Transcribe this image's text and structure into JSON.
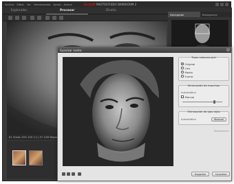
{
  "app": {
    "menu": [
      "Archivo",
      "Editar",
      "Ver",
      "Herramientas",
      "Ayuda",
      "Acerca"
    ],
    "brand": "ArcSoft",
    "title": "PHOTOSTUDIO DARKROOM 2",
    "modes": [
      "Explorador",
      "Procesar",
      "Diseño"
    ],
    "active_mode": "Procesar",
    "status": "81 Grises 15% 100 1:1 | 57 1/50 Negro",
    "right_tabs": [
      "Navegador",
      "Histograma"
    ]
  },
  "dialog": {
    "title": "Suavizar rostro",
    "skin_type": {
      "title": "Tipos máscara piel",
      "options": [
        "Original",
        "Liso",
        "Medio",
        "Fuerte"
      ],
      "selected": "Original"
    },
    "spots": {
      "title": "Eliminación de manchas",
      "auto_label": "Automático",
      "manual_label": "Manual",
      "level": 0.8
    },
    "wrinkles": {
      "title": "Eliminación de ojos rojos",
      "auto_label": "Automático",
      "manual_label": "Manual"
    },
    "reset_label": "Restablecer",
    "apply_label": "Aplicar",
    "export_label": "Exportar",
    "cancel_label": "Cancelar"
  },
  "icons": [
    "zoom-in-icon",
    "zoom-out-icon",
    "fit-icon",
    "compare-icon"
  ]
}
